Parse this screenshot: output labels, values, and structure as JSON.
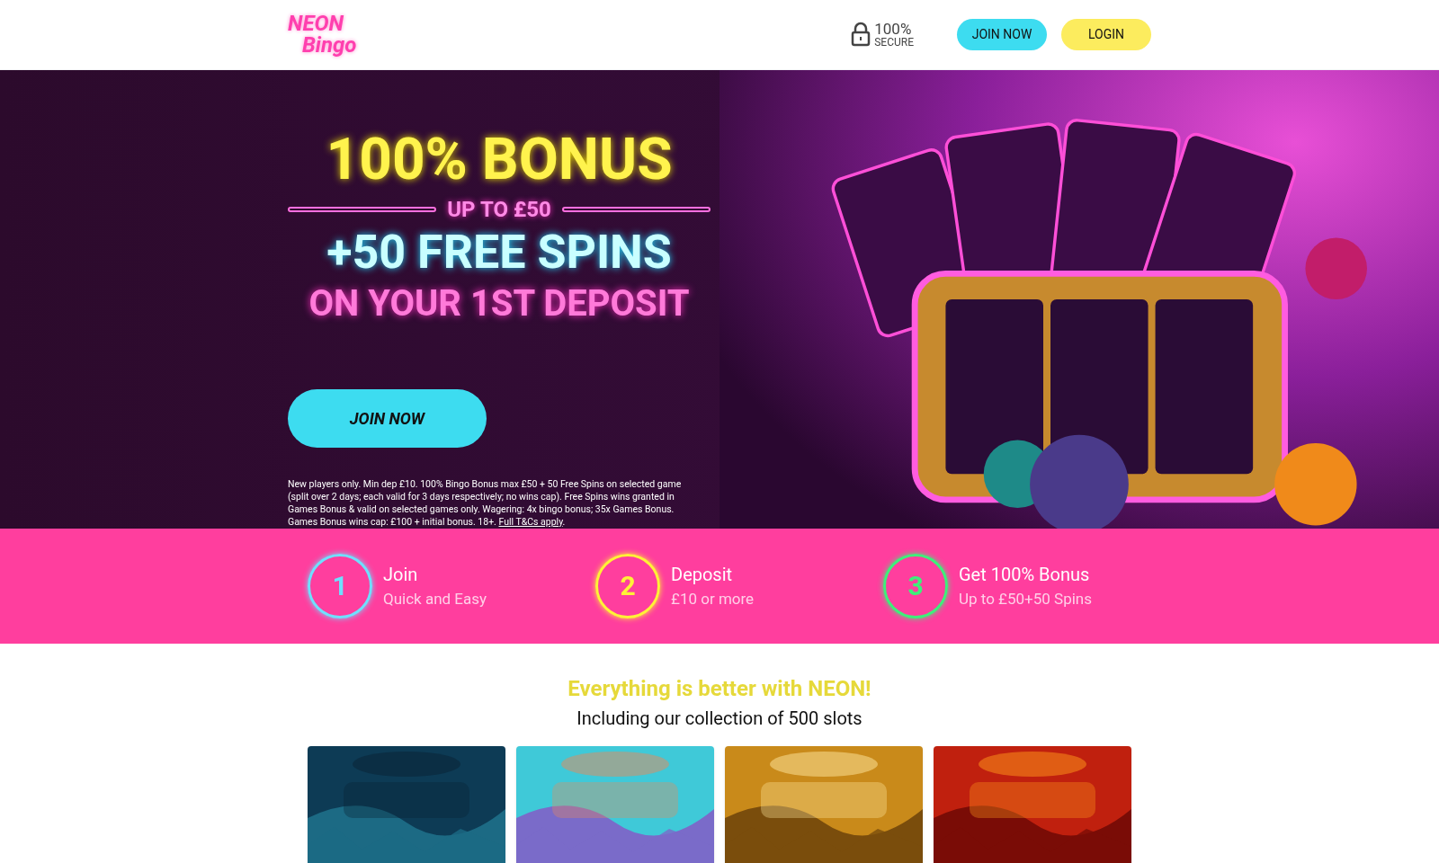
{
  "header": {
    "logo": {
      "top": "NEON",
      "bottom": "Bingo"
    },
    "secure": {
      "big": "100%",
      "small": "SECURE"
    },
    "buttons": [
      {
        "label": "JOIN NOW",
        "kind": "join"
      },
      {
        "label": "LOGIN",
        "kind": "login"
      }
    ]
  },
  "hero": {
    "headline": [
      {
        "text": "100% BONUS",
        "kind": "big"
      },
      {
        "text": "UP TO £50",
        "kind": "divider"
      },
      {
        "text": "+50 FREE SPINS",
        "kind": "cyan"
      },
      {
        "text": "ON YOUR 1ST DEPOSIT",
        "kind": "pink"
      }
    ],
    "cta": "JOIN NOW",
    "terms": "New players only. Min dep £10. 100% Bingo Bonus max £50 + 50 Free Spins on selected game (split over 2 days; each valid for 3 days respectively; no wins cap). Free Spins wins granted in Games Bonus & valid on selected games only. Wagering: 4x bingo bonus; 35x Games Bonus. Games Bonus wins cap: £100 + initial bonus. 18+.",
    "terms_link": "Full T&Cs apply",
    "terms_end": "."
  },
  "steps": [
    {
      "number": "1",
      "title": "Join",
      "subtitle": "Quick and Easy",
      "color": "#6fe0ff"
    },
    {
      "number": "2",
      "title": "Deposit",
      "subtitle": "£10 or more",
      "color": "#fff236"
    },
    {
      "number": "3",
      "title": "Get 100% Bonus",
      "subtitle": "Up to £50+50 Spins",
      "color": "#3df07a"
    }
  ],
  "slots": {
    "title": "Everything is better with NEON!",
    "subtitle": "Including our collection of 500 slots"
  }
}
